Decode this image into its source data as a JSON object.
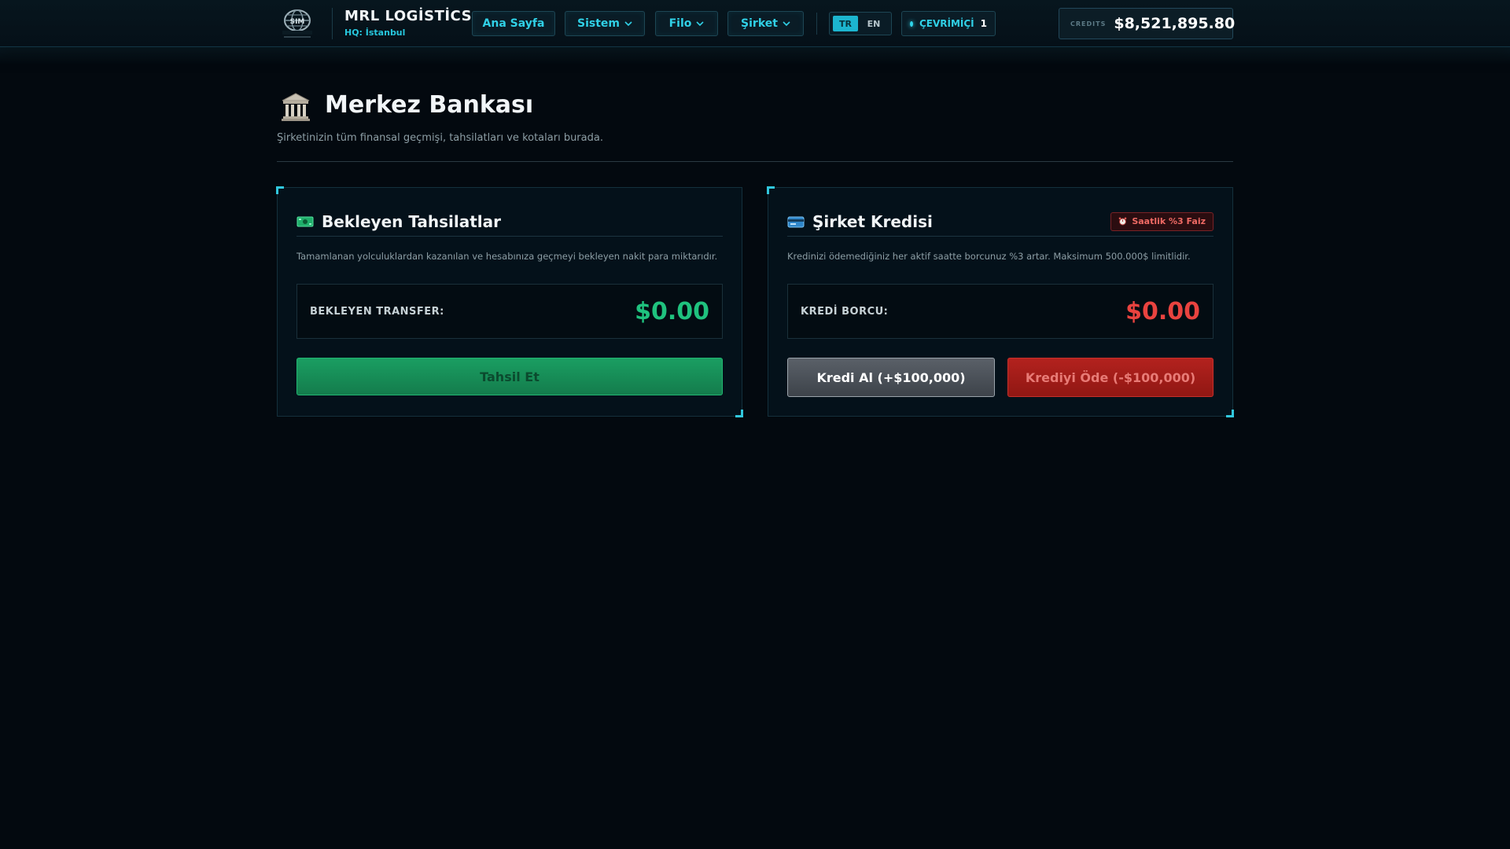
{
  "header": {
    "logo_text": "SIM",
    "brand_name": "MRL LOGİSTİCS",
    "hq": "HQ: İstanbul",
    "nav": [
      {
        "label": "Ana Sayfa"
      },
      {
        "label": "Sistem"
      },
      {
        "label": "Filo"
      },
      {
        "label": "Şirket"
      }
    ],
    "lang": {
      "tr": "TR",
      "en": "EN",
      "active": "TR"
    },
    "online": {
      "label": "ÇEVRİMİÇİ",
      "count": "1"
    },
    "credits": {
      "label": "CREDITS",
      "value": "$8,521,895.80"
    }
  },
  "page": {
    "icon": "bank-icon",
    "title": "Merkez Bankası",
    "subtitle": "Şirketinizin tüm finansal geçmişi, tahsilatları ve kotaları burada."
  },
  "pending": {
    "icon": "cash-icon",
    "title": "Bekleyen Tahsilatlar",
    "description": "Tamamlanan yolculuklardan kazanılan ve hesabınıza geçmeyi bekleyen nakit para miktarıdır.",
    "amount_label": "BEKLEYEN TRANSFER:",
    "amount_value": "$0.00",
    "collect_button": "Tahsil Et"
  },
  "credit": {
    "icon": "credit-card-icon",
    "title": "Şirket Kredisi",
    "badge": "Saatlik %3 Faiz",
    "badge_icon": "alarm-icon",
    "description": "Kredinizi ödemediğiniz her aktif saatte borcunuz %3 artar. Maksimum 500.000$ limitlidir.",
    "amount_label": "KREDİ BORCU:",
    "amount_value": "$0.00",
    "take_loan_button": "Kredi Al (+$100,000)",
    "repay_button": "Krediyi Öde (-$100,000)"
  },
  "colors": {
    "accent": "#30d0e6",
    "positive": "#1fc27e",
    "negative": "#e9433f",
    "background": "#03090f"
  }
}
